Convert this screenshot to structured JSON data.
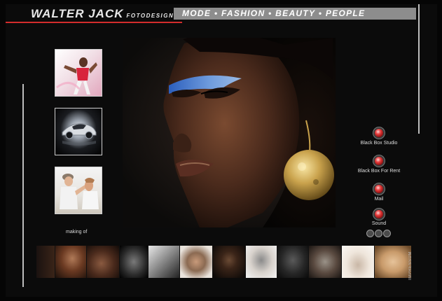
{
  "brand": {
    "name": "WALTER JACK",
    "sub": "FOTODESIGN",
    "accent": "#d42c2c"
  },
  "nav": {
    "text": "MODE • FASHION • BEAUTY • PEOPLE",
    "bar_color": "#8d8d8d"
  },
  "thumbnails": [
    {
      "icon": "fashion-model-photo"
    },
    {
      "icon": "sports-car-photo"
    },
    {
      "icon": "makeup-artist-photo"
    }
  ],
  "making_of": "making of",
  "hero": {
    "icon": "beauty-portrait-photo"
  },
  "menu": [
    {
      "label": "Black Box Studio"
    },
    {
      "label": "Black Box For Rent"
    },
    {
      "label": "Mail"
    },
    {
      "label": "Sound"
    }
  ],
  "pager": [
    {
      "icon": "pager-dot"
    },
    {
      "icon": "pager-dot"
    },
    {
      "icon": "pager-dot"
    }
  ],
  "filmstrip": [
    {
      "tone": "#6b3a22"
    },
    {
      "tone": "#4a2a1c"
    },
    {
      "tone": "#2a2a2a"
    },
    {
      "tone": "#bdbdbd"
    },
    {
      "tone": "#8b6a52"
    },
    {
      "tone": "#1c1c1c"
    },
    {
      "tone": "#d8d2cc"
    },
    {
      "tone": "#262626"
    },
    {
      "tone": "#5a4a40"
    },
    {
      "tone": "#9a9288"
    },
    {
      "tone": "#efe6dc"
    },
    {
      "tone": "#c89a6a"
    }
  ],
  "vertical_text": "IMPRESSUM"
}
